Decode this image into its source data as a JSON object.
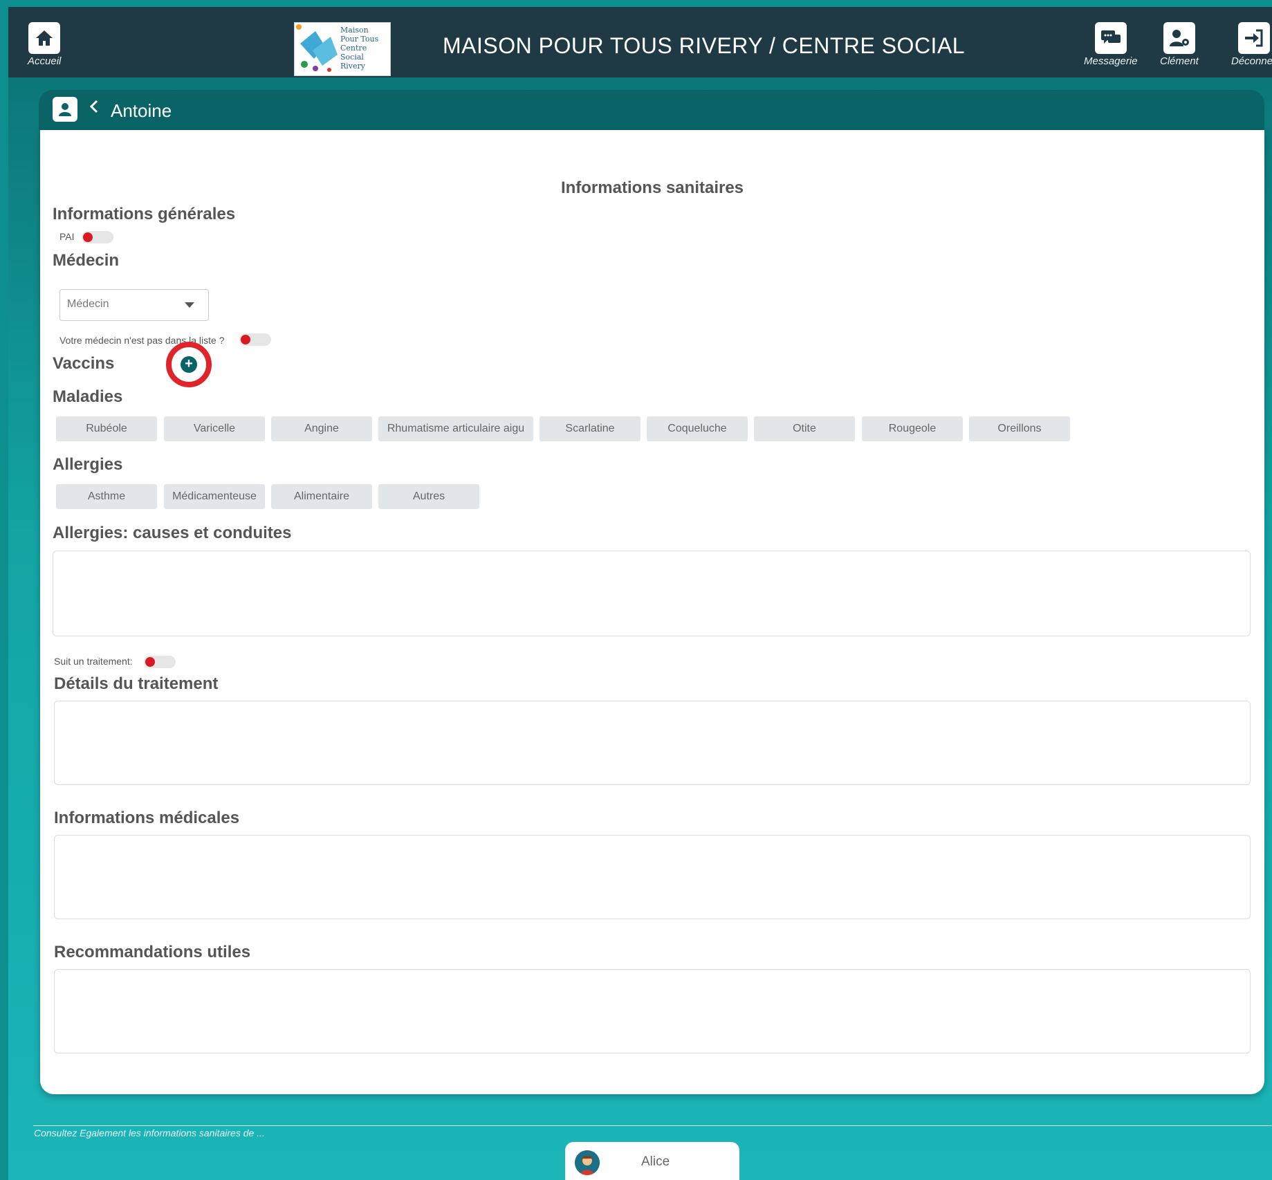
{
  "header": {
    "title": "MAISON POUR TOUS RIVERY / CENTRE SOCIAL",
    "home_label": "Accueil",
    "messaging_label": "Messagerie",
    "user_label": "Clément",
    "logout_label": "Déconnexio",
    "logo_text": "Maison Pour Tous Centre Social Rivery"
  },
  "card": {
    "back_icon": "chevron-left-icon",
    "person_name": "Antoine"
  },
  "page": {
    "heading": "Informations sanitaires",
    "general_title": "Informations générales",
    "pai_label": "PAI",
    "doctor_title": "Médecin",
    "doctor_placeholder": "Médecin",
    "doctor_not_listed_label": "Votre médecin n'est pas dans la liste ?",
    "vaccines_title": "Vaccins",
    "diseases_title": "Maladies",
    "diseases": [
      "Rubéole",
      "Varicelle",
      "Angine",
      "Rhumatisme articulaire aigu",
      "Scarlatine",
      "Coqueluche",
      "Otite",
      "Rougeole",
      "Oreillons"
    ],
    "allergies_title": "Allergies",
    "allergies": [
      "Asthme",
      "Médicamenteuse",
      "Alimentaire",
      "Autres"
    ],
    "allergy_causes_title": "Allergies: causes et conduites",
    "treatment_label": "Suit un traitement:",
    "treatment_details_title": "Détails du traitement",
    "medical_info_title": "Informations médicales",
    "recommendations_title": "Recommandations utiles"
  },
  "footer": {
    "text": "Consultez Egalement les informations sanitaires de ...",
    "child_name": "Alice"
  },
  "colors": {
    "accent": "#0a6467",
    "topbar": "#1f3a45",
    "toggle_off_dot": "#d81b22",
    "highlight_ring": "#e0242b"
  }
}
